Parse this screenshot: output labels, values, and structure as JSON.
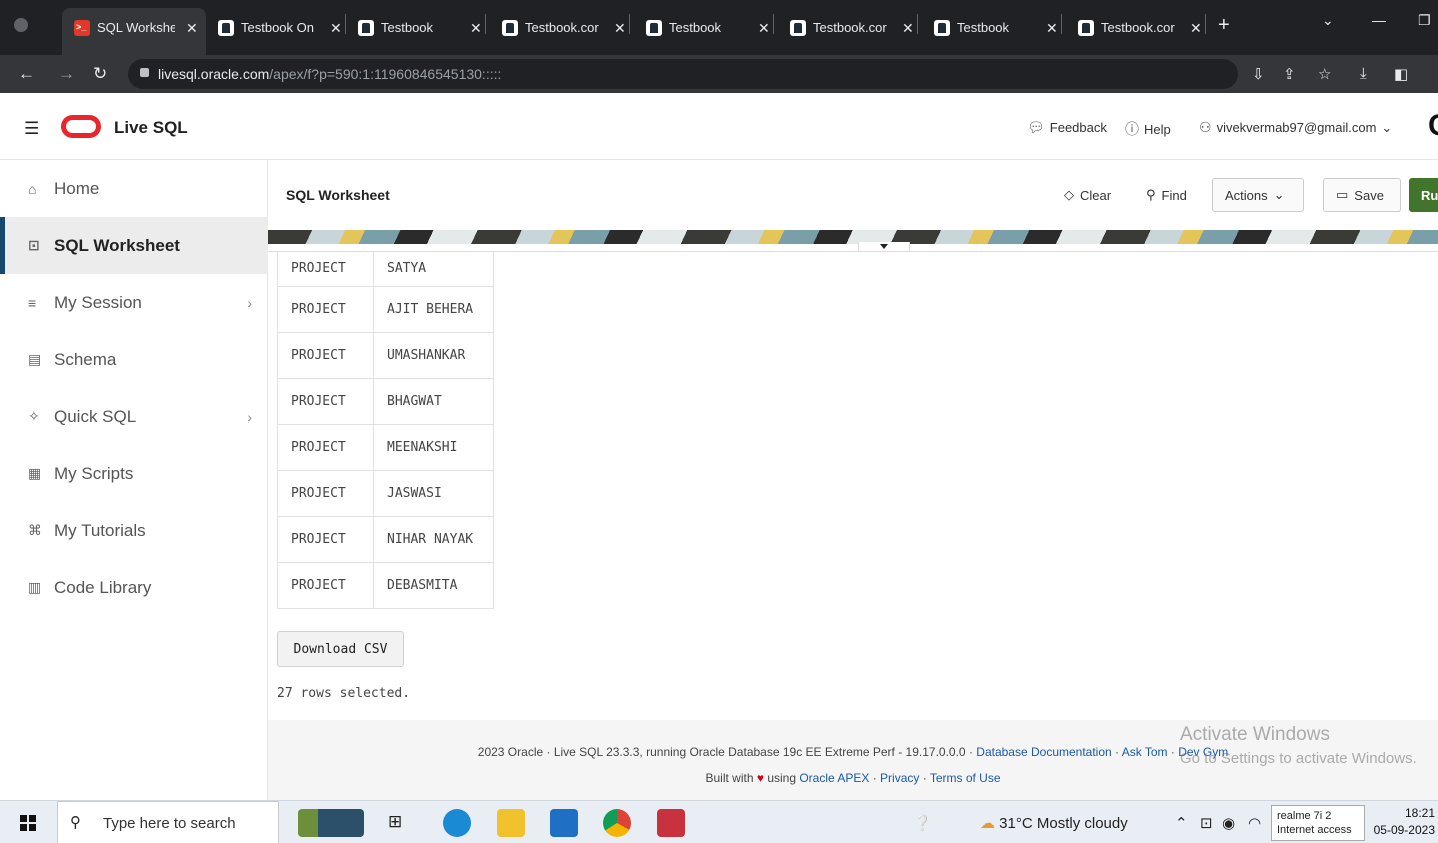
{
  "browser": {
    "tabs": [
      {
        "title": "SQL Workshe",
        "active": true
      },
      {
        "title": "Testbook On"
      },
      {
        "title": "Testbook"
      },
      {
        "title": "Testbook.cor"
      },
      {
        "title": "Testbook"
      },
      {
        "title": "Testbook.cor"
      },
      {
        "title": "Testbook"
      },
      {
        "title": "Testbook.cor"
      }
    ],
    "url_host": "livesql.oracle.com",
    "url_path": "/apex/f?p=590:1:11960846545130:::::"
  },
  "app": {
    "name": "Live SQL",
    "header_links": {
      "feedback": "Feedback",
      "help": "Help",
      "user": "vivekvermab97@gmail.com"
    }
  },
  "sidebar": {
    "items": [
      {
        "label": "Home",
        "icon": "home-icon"
      },
      {
        "label": "SQL Worksheet",
        "icon": "terminal-icon",
        "active": true
      },
      {
        "label": "My Session",
        "icon": "list-icon",
        "chevron": true
      },
      {
        "label": "Schema",
        "icon": "database-icon"
      },
      {
        "label": "Quick SQL",
        "icon": "wand-icon",
        "chevron": true
      },
      {
        "label": "My Scripts",
        "icon": "script-icon"
      },
      {
        "label": "My Tutorials",
        "icon": "graduation-icon"
      },
      {
        "label": "Code Library",
        "icon": "library-icon"
      }
    ]
  },
  "worksheet": {
    "title": "SQL Worksheet",
    "clear_label": "Clear",
    "find_label": "Find",
    "actions_label": "Actions",
    "save_label": "Save",
    "run_label": "Ru"
  },
  "results": {
    "rows": [
      [
        "PROJECT",
        "SATYA"
      ],
      [
        "PROJECT",
        "AJIT BEHERA"
      ],
      [
        "PROJECT",
        "UMASHANKAR"
      ],
      [
        "PROJECT",
        "BHAGWAT"
      ],
      [
        "PROJECT",
        "MEENAKSHI"
      ],
      [
        "PROJECT",
        "JASWASI"
      ],
      [
        "PROJECT",
        "NIHAR NAYAK"
      ],
      [
        "PROJECT",
        "DEBASMITA"
      ]
    ],
    "download_label": "Download CSV",
    "status": "27 rows selected."
  },
  "footer": {
    "line1_prefix": "2023 Oracle · Live SQL 23.3.3, running Oracle Database 19c EE Extreme Perf - 19.17.0.0.0 ·",
    "doc_link": "Database Documentation",
    "ask_tom": "Ask Tom",
    "dev_gym": "Dev Gym",
    "built_with": "Built with",
    "using": "using",
    "apex_link": "Oracle APEX",
    "privacy_link": "Privacy",
    "terms_link": "Terms of Use"
  },
  "watermark": {
    "title": "Activate Windows",
    "subtitle": "Go to Settings to activate Windows."
  },
  "taskbar": {
    "search_placeholder": "Type here to search",
    "weather": "31°C  Mostly cloudy",
    "network_name": "realme 7i 2",
    "network_status": "Internet access",
    "time": "18:21",
    "date": "05-09-2023"
  }
}
